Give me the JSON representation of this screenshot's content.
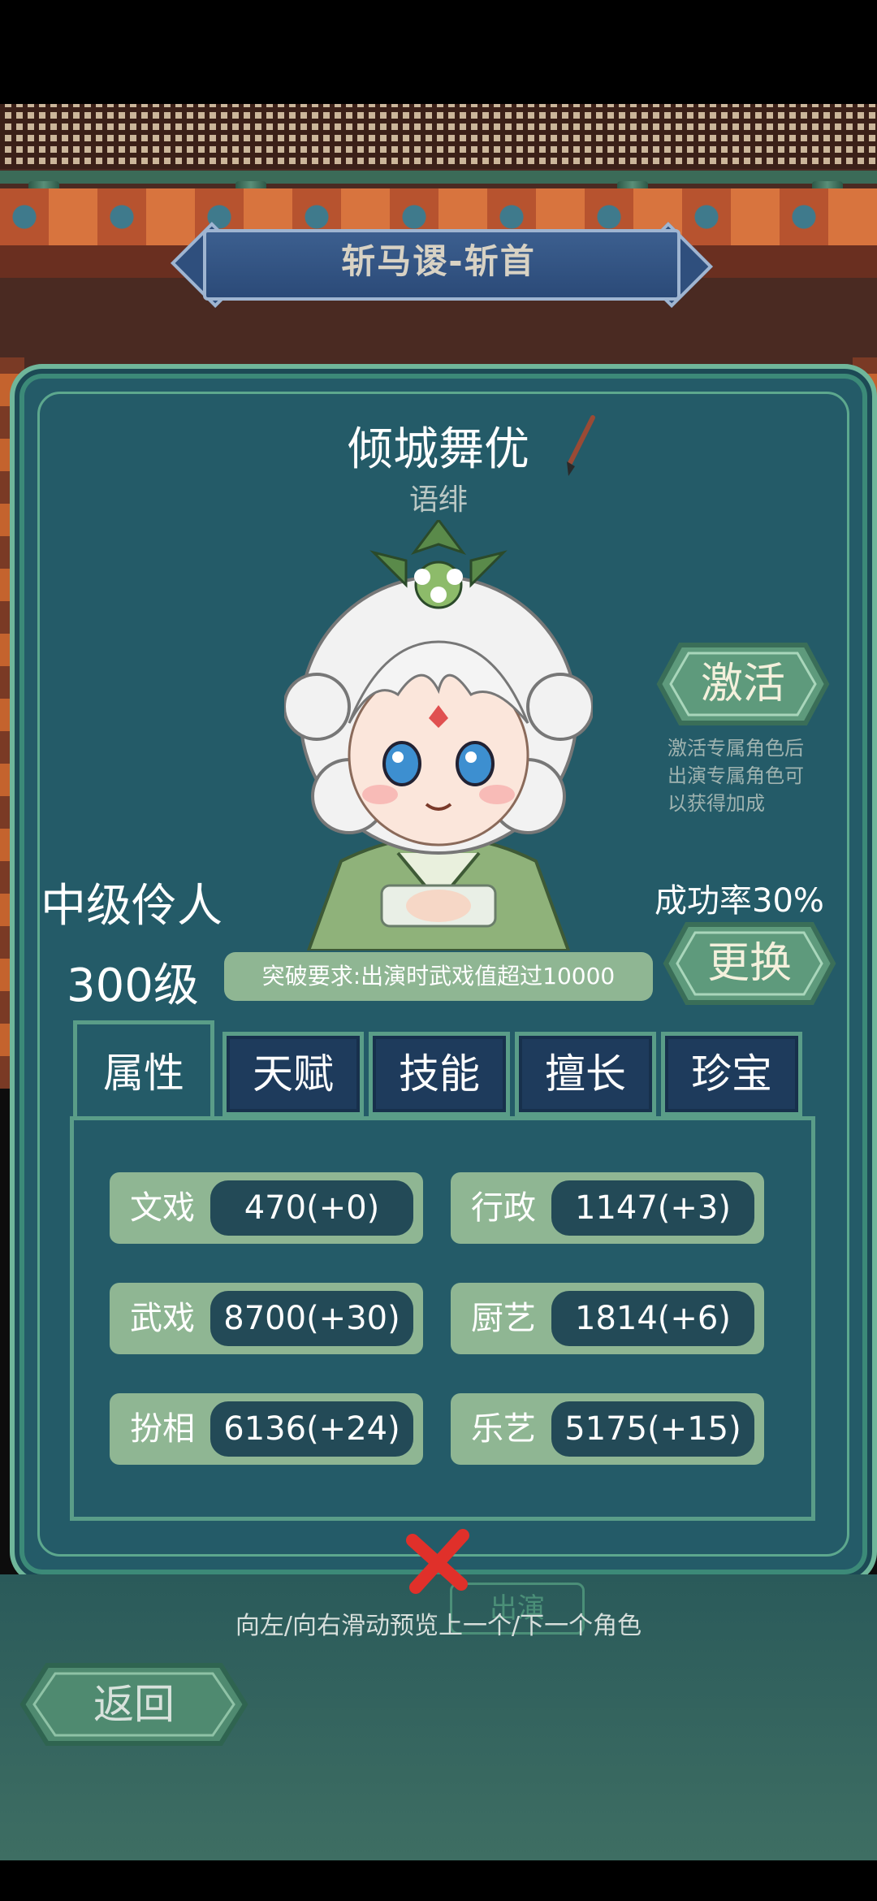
{
  "banner": {
    "title": "斩马谡-斩首"
  },
  "character": {
    "name": "倾城舞优",
    "subname": "语绯",
    "rank": "中级伶人",
    "level": "300级",
    "requirement": "突破要求:出演时武戏值超过10000",
    "success_rate": "成功率30%"
  },
  "actions": {
    "activate": "激活",
    "activate_desc": [
      "激活专属角色后",
      "出演专属角色可",
      "以获得加成"
    ],
    "change": "更换",
    "perform": "出演",
    "back": "返回"
  },
  "tabs": [
    "属性",
    "天赋",
    "技能",
    "擅长",
    "珍宝"
  ],
  "stats": [
    {
      "label": "文戏",
      "value": "470(+0)"
    },
    {
      "label": "行政",
      "value": "1147(+3)"
    },
    {
      "label": "武戏",
      "value": "8700(+30)"
    },
    {
      "label": "厨艺",
      "value": "1814(+6)"
    },
    {
      "label": "扮相",
      "value": "6136(+24)"
    },
    {
      "label": "乐艺",
      "value": "5175(+15)"
    }
  ],
  "hint": "向左/向右滑动预览上一个/下一个角色",
  "colors": {
    "panel": "#245b68",
    "accent": "#8fb693",
    "close": "#e0302a"
  }
}
